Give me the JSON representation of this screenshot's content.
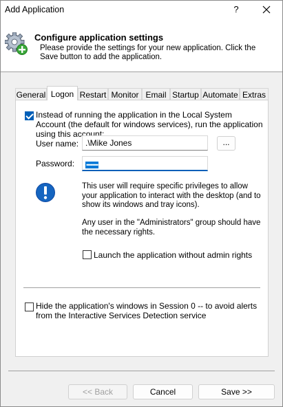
{
  "window": {
    "title": "Add Application",
    "help_label": "?"
  },
  "header": {
    "title": "Configure application settings",
    "description": "Please provide the settings for your new application. Click the Save button to add the application.",
    "icon": "gear-add-icon"
  },
  "tabs": [
    {
      "label": "General",
      "active": false
    },
    {
      "label": "Logon",
      "active": true
    },
    {
      "label": "Restart",
      "active": false
    },
    {
      "label": "Monitor",
      "active": false
    },
    {
      "label": "Email",
      "active": false
    },
    {
      "label": "Startup",
      "active": false
    },
    {
      "label": "Automate",
      "active": false
    },
    {
      "label": "Extras",
      "active": false
    }
  ],
  "logon": {
    "run_as_account_checked": true,
    "run_as_account_label": "Instead of running the application in the Local System Account (the default for windows services), run the application using this account:",
    "user_name_label": "User name:",
    "user_name_value": ".\\Mike Jones",
    "browse_label": "...",
    "password_label": "Password:",
    "password_value": "••••••••",
    "info_icon": "exclamation-icon",
    "info_text_1": "This user will require specific privileges to allow your application to interact with the desktop (and to show its windows and tray icons).",
    "info_text_2": "Any user in the \"Administrators\" group should have the necessary rights.",
    "launch_without_admin_checked": false,
    "launch_without_admin_label": "Launch the application without admin rights",
    "hide_session0_checked": false,
    "hide_session0_label": "Hide the application's windows in Session 0 -- to avoid alerts from the Interactive Services Detection service"
  },
  "footer": {
    "back_label": "<< Back",
    "cancel_label": "Cancel",
    "save_label": "Save >>"
  },
  "colors": {
    "accent": "#005fb8",
    "selection": "#0078d7",
    "info_blue": "#1565c0"
  }
}
